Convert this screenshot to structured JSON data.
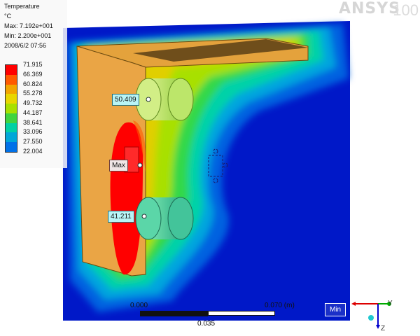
{
  "legend": {
    "title": "Temperature",
    "unit": "°C",
    "max": "Max: 7.192e+001",
    "min": "Min: 2.200e+001",
    "timestamp": "2008/6/2 07:56",
    "levels": [
      "71.915",
      "66.369",
      "60.824",
      "55.278",
      "49.732",
      "44.187",
      "38.641",
      "33.096",
      "27.550",
      "22.004"
    ],
    "colors": [
      "#ff0000",
      "#ff5a00",
      "#f2a500",
      "#e8d600",
      "#a8e000",
      "#3fd43f",
      "#00d1a4",
      "#00a7d8",
      "#0071e8",
      "#0016c8"
    ]
  },
  "probes": {
    "upper_value": "50.409",
    "max_label": "Max",
    "lower_value": "41.211"
  },
  "logo": {
    "brand": "ANSYS",
    "version": "100"
  },
  "scale": {
    "left": "0.000",
    "right": "0.070 (m)",
    "middle": "0.035"
  },
  "min_button": "Min",
  "triad": {
    "y": "Y",
    "z": "Z"
  },
  "colors": {
    "background": "#0018c8",
    "plate": "#e4a23c",
    "hotspot": "#ff0000",
    "component": "#b8ea4e"
  }
}
